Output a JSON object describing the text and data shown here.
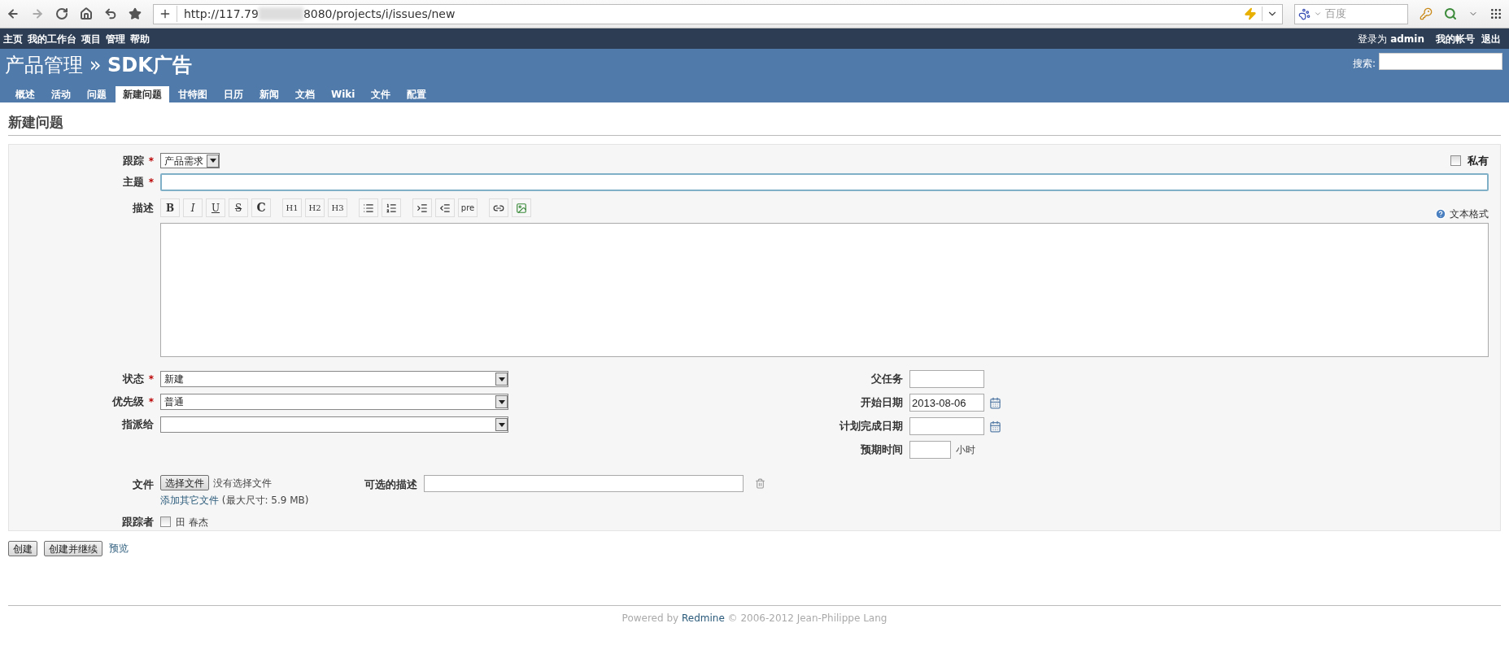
{
  "browser": {
    "url_start": "http://117.79",
    "url_end": "8080/projects/i/issues/new",
    "search_placeholder": "百度"
  },
  "top_menu": {
    "items": [
      "主页",
      "我的工作台",
      "项目",
      "管理",
      "帮助"
    ],
    "logged_in_prefix": "登录为",
    "user": "admin",
    "account_items": [
      "我的帐号",
      "退出"
    ]
  },
  "header": {
    "title": "产品管理 » **SDK广告**",
    "search_label": "搜索:"
  },
  "tabs": [
    {
      "label": "概述",
      "selected": false
    },
    {
      "label": "活动",
      "selected": false
    },
    {
      "label": "问题",
      "selected": false
    },
    {
      "label": "新建问题",
      "selected": true
    },
    {
      "label": "甘特图",
      "selected": false
    },
    {
      "label": "日历",
      "selected": false
    },
    {
      "label": "新闻",
      "selected": false
    },
    {
      "label": "文档",
      "selected": false
    },
    {
      "label": "Wiki",
      "selected": false
    },
    {
      "label": "文件",
      "selected": false
    },
    {
      "label": "配置",
      "selected": false
    }
  ],
  "page_title": "新建问题",
  "form": {
    "tracker": {
      "label": "跟踪",
      "required_mark": "*",
      "value": "产品需求"
    },
    "private": {
      "label": "私有",
      "checked": false
    },
    "subject": {
      "label": "主题",
      "required_mark": "*"
    },
    "description": {
      "label": "描述",
      "text_format": "文本格式",
      "toolbar": [
        [
          {
            "kind": "bold",
            "label": "B"
          },
          {
            "kind": "italic",
            "label": "I"
          },
          {
            "kind": "underline",
            "label": "U"
          },
          {
            "kind": "strike",
            "label": "S"
          },
          {
            "kind": "code",
            "label": "C"
          }
        ],
        [
          {
            "kind": "heading",
            "label": "H1"
          },
          {
            "kind": "heading",
            "label": "H2"
          },
          {
            "kind": "heading",
            "label": "H3"
          }
        ],
        [
          {
            "kind": "ul"
          },
          {
            "kind": "ol"
          }
        ],
        [
          {
            "kind": "indent"
          },
          {
            "kind": "outdent"
          },
          {
            "kind": "pre",
            "label": "pre"
          }
        ],
        [
          {
            "kind": "link"
          },
          {
            "kind": "image"
          }
        ]
      ]
    },
    "left_fields": [
      {
        "label": "状态",
        "required_mark": "*",
        "value": "新建"
      },
      {
        "label": "优先级",
        "required_mark": "*",
        "value": "普通"
      },
      {
        "label": "指派给"
      }
    ],
    "right_fields": [
      {
        "label": "父任务",
        "kind": "text"
      },
      {
        "label": "开始日期",
        "kind": "date",
        "value": "2013-08-06"
      },
      {
        "label": "计划完成日期",
        "kind": "date"
      },
      {
        "label": "预期时间",
        "kind": "hours",
        "unit": "小时"
      }
    ],
    "file": {
      "label": "文件",
      "button": "选择文件",
      "status": "没有选择文件",
      "description_label": "可选的描述",
      "add_link": "添加其它文件",
      "max_size": "(最大尺寸: 5.9 MB)"
    },
    "watchers": {
      "label": "跟踪者",
      "users": [
        {
          "name": "田 春杰",
          "checked": false
        }
      ]
    }
  },
  "buttons": [
    "创建",
    "创建并继续"
  ],
  "preview": "预览",
  "footer": {
    "prefix": "Powered by",
    "link": "Redmine",
    "suffix": "© 2006-2012 Jean-Philippe Lang"
  }
}
